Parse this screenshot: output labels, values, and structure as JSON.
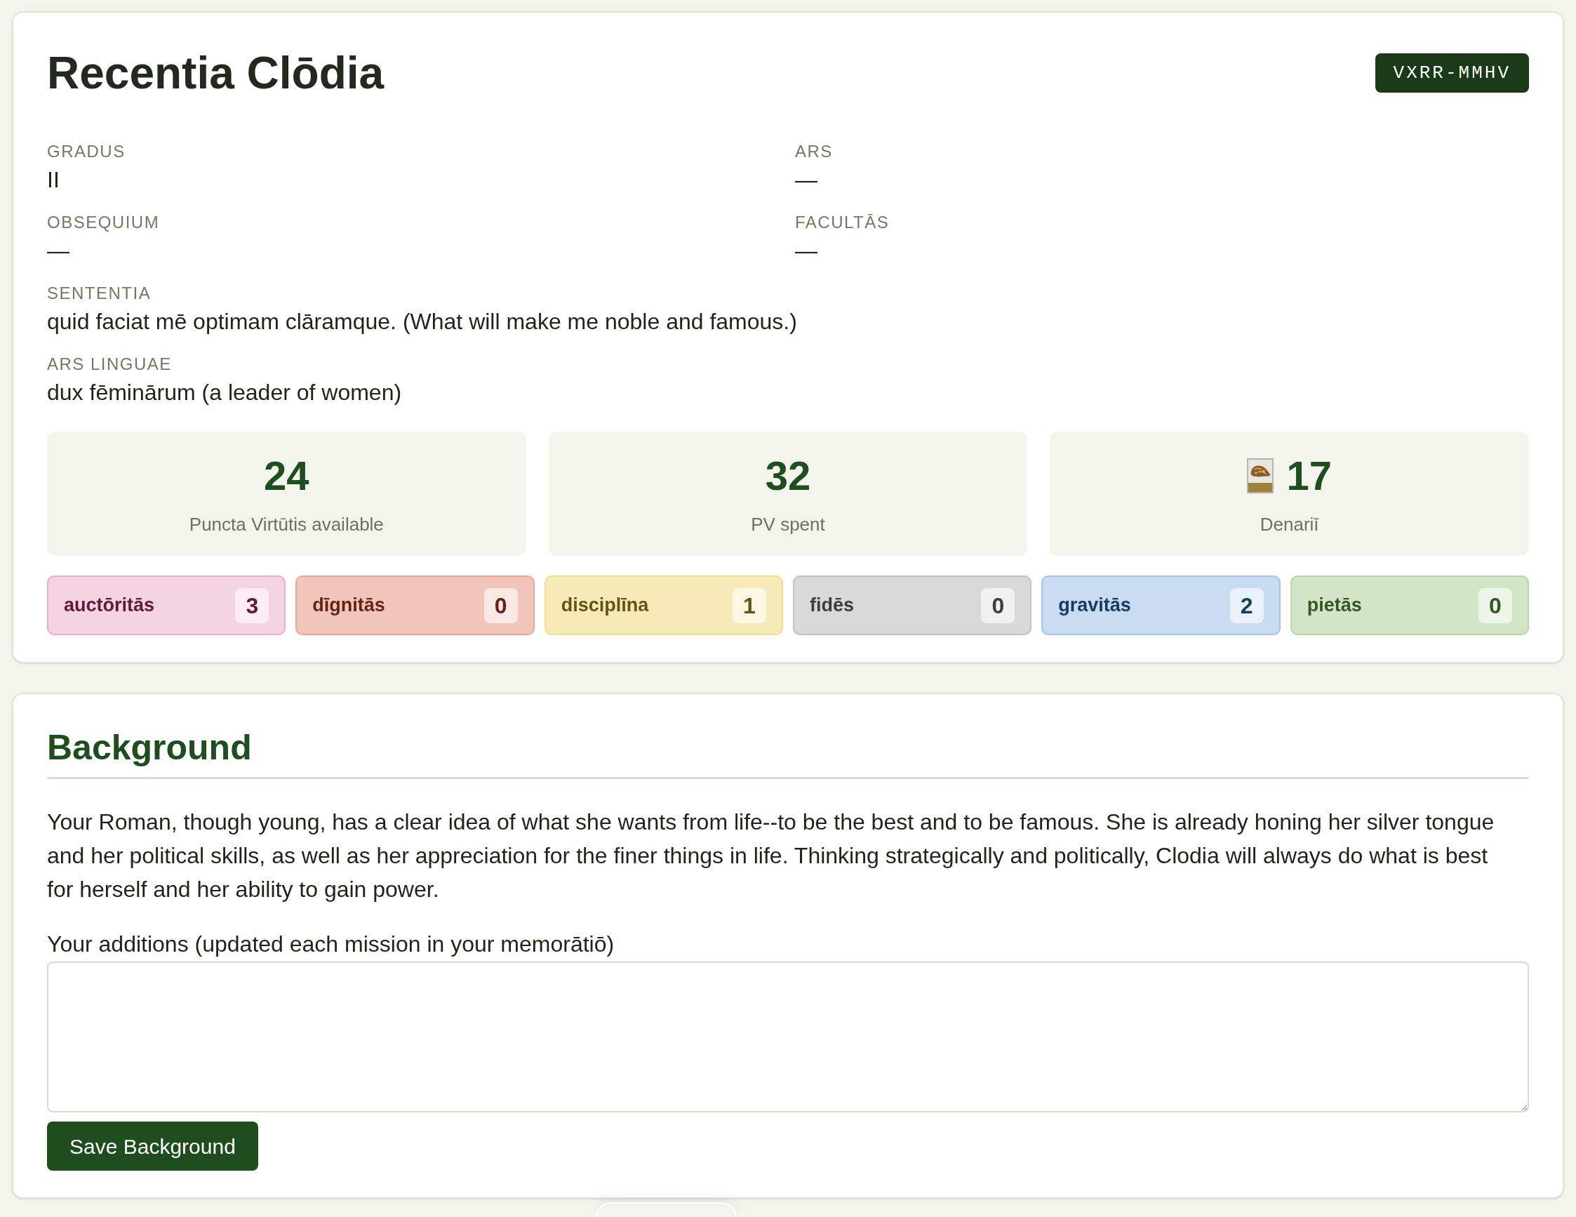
{
  "character": {
    "name": "Recentia Clōdia",
    "code": "VXRR-MMHV",
    "attributes": [
      {
        "label": "GRADUS",
        "value": "II"
      },
      {
        "label": "ARS",
        "value": "—"
      },
      {
        "label": "OBSEQUIUM",
        "value": "—"
      },
      {
        "label": "FACULTĀS",
        "value": "—"
      }
    ],
    "details": [
      {
        "label": "SENTENTIA",
        "value": "quid faciat mē optimam clāramque. (What will make me noble and famous.)"
      },
      {
        "label": "ARS LINGUAE",
        "value": "dux fēminārum (a leader of women)"
      }
    ],
    "stats": [
      {
        "kind": "count",
        "value": "24",
        "label": "Puncta Virtūtis available"
      },
      {
        "kind": "count",
        "value": "32",
        "label": "PV spent"
      },
      {
        "kind": "currency",
        "value": "17",
        "label": "Denariī"
      }
    ],
    "virtues": [
      {
        "name": "auctōritās",
        "score": "3",
        "color": "#f4d3e2"
      },
      {
        "name": "dīgnitās",
        "score": "0",
        "color": "#f2c5bb"
      },
      {
        "name": "disciplīna",
        "score": "1",
        "color": "#f6ebb8"
      },
      {
        "name": "fidēs",
        "score": "0",
        "color": "#d9d9d9"
      },
      {
        "name": "gravitās",
        "score": "2",
        "color": "#c8dbf1"
      },
      {
        "name": "pietās",
        "score": "0",
        "color": "#d2e5c6"
      }
    ]
  },
  "background": {
    "title": "Background",
    "text": "Your Roman, though young, has a clear idea of what she wants from life--to be the best and to be famous. She is already honing her silver tongue and her political skills, as well as her appreciation for the finer things in life. Thinking strategically and politically, Clodia will always do what is best for herself and her ability to gain power.",
    "additions_label": "Your additions (updated each mission in your memorātiō)",
    "save_button": "Save Background"
  }
}
